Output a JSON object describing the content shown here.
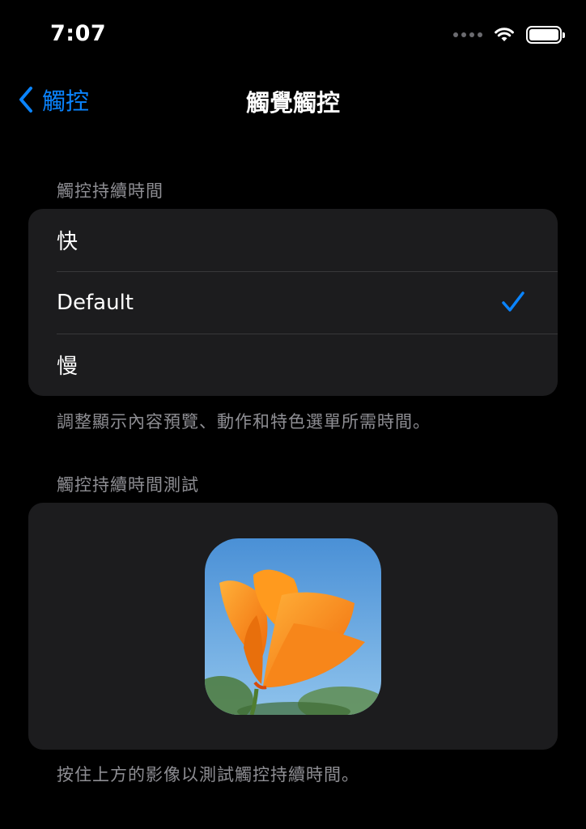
{
  "status_bar": {
    "time": "7:07"
  },
  "nav": {
    "back_label": "觸控",
    "title": "觸覺觸控"
  },
  "duration_section": {
    "header": "觸控持續時間",
    "options": [
      {
        "label": "快",
        "selected": false
      },
      {
        "label": "Default",
        "selected": true
      },
      {
        "label": "慢",
        "selected": false
      }
    ],
    "footer": "調整顯示內容預覽、動作和特色選單所需時間。"
  },
  "test_section": {
    "header": "觸控持續時間測試",
    "image_icon": "orange-poppy-photo",
    "footer": "按住上方的影像以測試觸控持續時間。"
  },
  "colors": {
    "accent": "#0a84ff",
    "background": "#000000",
    "group_background": "#1c1c1e",
    "secondary_text": "#8e8e93"
  }
}
